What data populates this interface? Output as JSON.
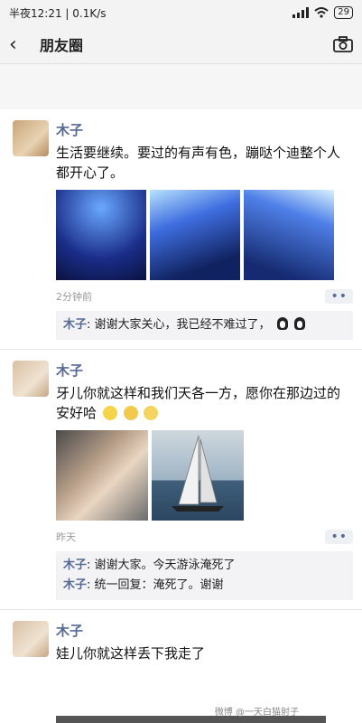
{
  "status": {
    "time": "半夜12:21",
    "speed": "0.1K/s",
    "battery": "29"
  },
  "nav": {
    "title": "朋友圈"
  },
  "posts": [
    {
      "name": "木子",
      "text": "生活要继续。要过的有声有色，蹦哒个迪整个人都开心了。",
      "time": "2分钟前",
      "more": "••",
      "comments": [
        {
          "name": "木子",
          "text": "谢谢大家关心，我已经不难过了，"
        }
      ]
    },
    {
      "name": "木子",
      "text": "牙儿你就这样和我们天各一方，愿你在那边过的安好哈",
      "time": "昨天",
      "more": "••",
      "comments": [
        {
          "name": "木子",
          "text": "谢谢大家。今天游泳淹死了"
        },
        {
          "name": "木子",
          "text": "统一回复：淹死了。谢谢"
        }
      ]
    },
    {
      "name": "木子",
      "text": "娃儿你就这样丢下我走了"
    }
  ],
  "watermark": "微博 @一天白猫射子"
}
